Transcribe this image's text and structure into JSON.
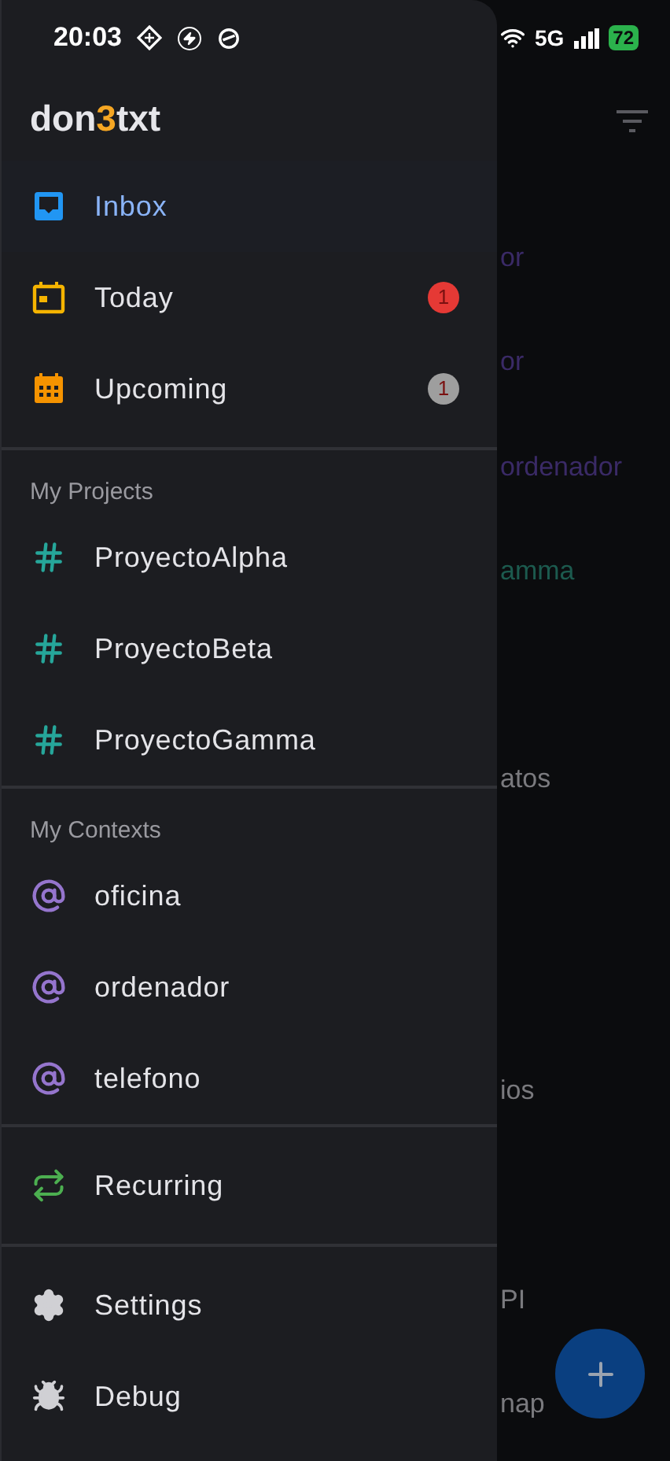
{
  "status_bar": {
    "time": "20:03",
    "network": "5G",
    "battery": "72"
  },
  "app_title": {
    "start": "don",
    "accent": "3",
    "end": "txt"
  },
  "top_items": [
    {
      "kind": "inbox",
      "label": "Inbox",
      "selected": true
    },
    {
      "kind": "today",
      "label": "Today",
      "selected": false,
      "badge": "1",
      "color": "#e53935"
    },
    {
      "kind": "upcoming",
      "label": "Upcoming",
      "selected": false,
      "badge": "1",
      "color": "#9e9e9e"
    }
  ],
  "sections": [
    {
      "title": "My Projects",
      "items": [
        {
          "kind": "project",
          "label": "ProyectoAlpha",
          "selected": false
        },
        {
          "kind": "project",
          "label": "ProyectoBeta",
          "selected": false
        },
        {
          "kind": "project",
          "label": "ProyectoGamma",
          "selected": false
        }
      ]
    },
    {
      "title": "My Contexts",
      "items": [
        {
          "kind": "context",
          "label": "oficina",
          "selected": false
        },
        {
          "kind": "context",
          "label": "ordenador",
          "selected": false
        },
        {
          "kind": "context",
          "label": "telefono",
          "selected": false
        }
      ]
    }
  ],
  "recurring": {
    "kind": "recurring",
    "label": "Recurring",
    "selected": false
  },
  "bottom_items": [
    {
      "kind": "settings",
      "label": "Settings",
      "selected": false
    },
    {
      "kind": "debug",
      "label": "Debug",
      "selected": false
    }
  ],
  "background_tasks": [
    {
      "text": "or",
      "color": "#3a2a66"
    },
    {
      "text": "or",
      "color": "#3a2a66"
    },
    {
      "text": "ordenador",
      "color": "#3a2a66"
    },
    {
      "text": "amma",
      "color": "#1c5a4e"
    },
    {
      "text": "atos",
      "color": "#7a7a7e"
    },
    {
      "text": "ios",
      "color": "#7a7a7e"
    },
    {
      "text": "PI",
      "color": "#7a7a7e"
    },
    {
      "text": "nap",
      "color": "#7a7a7e"
    }
  ]
}
